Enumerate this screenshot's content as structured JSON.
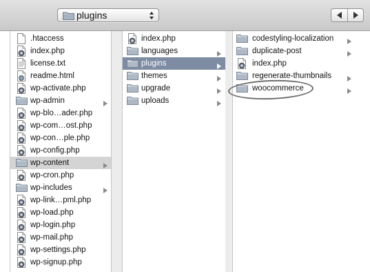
{
  "toolbar": {
    "path_label": "plugins",
    "path_icon": "folder-icon",
    "back_icon": "chevron-left-icon",
    "forward_icon": "chevron-right-icon"
  },
  "colors": {
    "selected_active": "#7d8ca3",
    "selected_inactive": "#d4d4d4",
    "annotation": "#6e6e6e"
  },
  "columns": [
    {
      "name": "wordpress-root",
      "items": [
        {
          "label": ".htaccess",
          "icon": "file-icon",
          "folder": false
        },
        {
          "label": "index.php",
          "icon": "php-file-icon",
          "folder": false
        },
        {
          "label": "license.txt",
          "icon": "text-file-icon",
          "folder": false
        },
        {
          "label": "readme.html",
          "icon": "html-file-icon",
          "folder": false
        },
        {
          "label": "wp-activate.php",
          "icon": "php-file-icon",
          "folder": false
        },
        {
          "label": "wp-admin",
          "icon": "folder-icon",
          "folder": true
        },
        {
          "label": "wp-blo…ader.php",
          "icon": "php-file-icon",
          "folder": false
        },
        {
          "label": "wp-com…ost.php",
          "icon": "php-file-icon",
          "folder": false
        },
        {
          "label": "wp-con…ple.php",
          "icon": "php-file-icon",
          "folder": false
        },
        {
          "label": "wp-config.php",
          "icon": "php-file-icon",
          "folder": false
        },
        {
          "label": "wp-content",
          "icon": "folder-icon",
          "folder": true,
          "selected": "inactive"
        },
        {
          "label": "wp-cron.php",
          "icon": "php-file-icon",
          "folder": false
        },
        {
          "label": "wp-includes",
          "icon": "folder-icon",
          "folder": true
        },
        {
          "label": "wp-link…pml.php",
          "icon": "php-file-icon",
          "folder": false
        },
        {
          "label": "wp-load.php",
          "icon": "php-file-icon",
          "folder": false
        },
        {
          "label": "wp-login.php",
          "icon": "php-file-icon",
          "folder": false
        },
        {
          "label": "wp-mail.php",
          "icon": "php-file-icon",
          "folder": false
        },
        {
          "label": "wp-settings.php",
          "icon": "php-file-icon",
          "folder": false
        },
        {
          "label": "wp-signup.php",
          "icon": "php-file-icon",
          "folder": false
        }
      ]
    },
    {
      "name": "wp-content",
      "items": [
        {
          "label": "index.php",
          "icon": "php-file-icon",
          "folder": false
        },
        {
          "label": "languages",
          "icon": "folder-icon",
          "folder": true
        },
        {
          "label": "plugins",
          "icon": "folder-icon",
          "folder": true,
          "selected": "active"
        },
        {
          "label": "themes",
          "icon": "folder-icon",
          "folder": true
        },
        {
          "label": "upgrade",
          "icon": "folder-icon",
          "folder": true
        },
        {
          "label": "uploads",
          "icon": "folder-icon",
          "folder": true
        }
      ]
    },
    {
      "name": "plugins",
      "items": [
        {
          "label": "codestyling-localization",
          "icon": "folder-icon",
          "folder": true
        },
        {
          "label": "duplicate-post",
          "icon": "folder-icon",
          "folder": true
        },
        {
          "label": "index.php",
          "icon": "php-file-icon",
          "folder": false
        },
        {
          "label": "regenerate-thumbnails",
          "icon": "folder-icon",
          "folder": true
        },
        {
          "label": "woocommerce",
          "icon": "folder-icon",
          "folder": true,
          "highlighted": true
        }
      ]
    }
  ]
}
